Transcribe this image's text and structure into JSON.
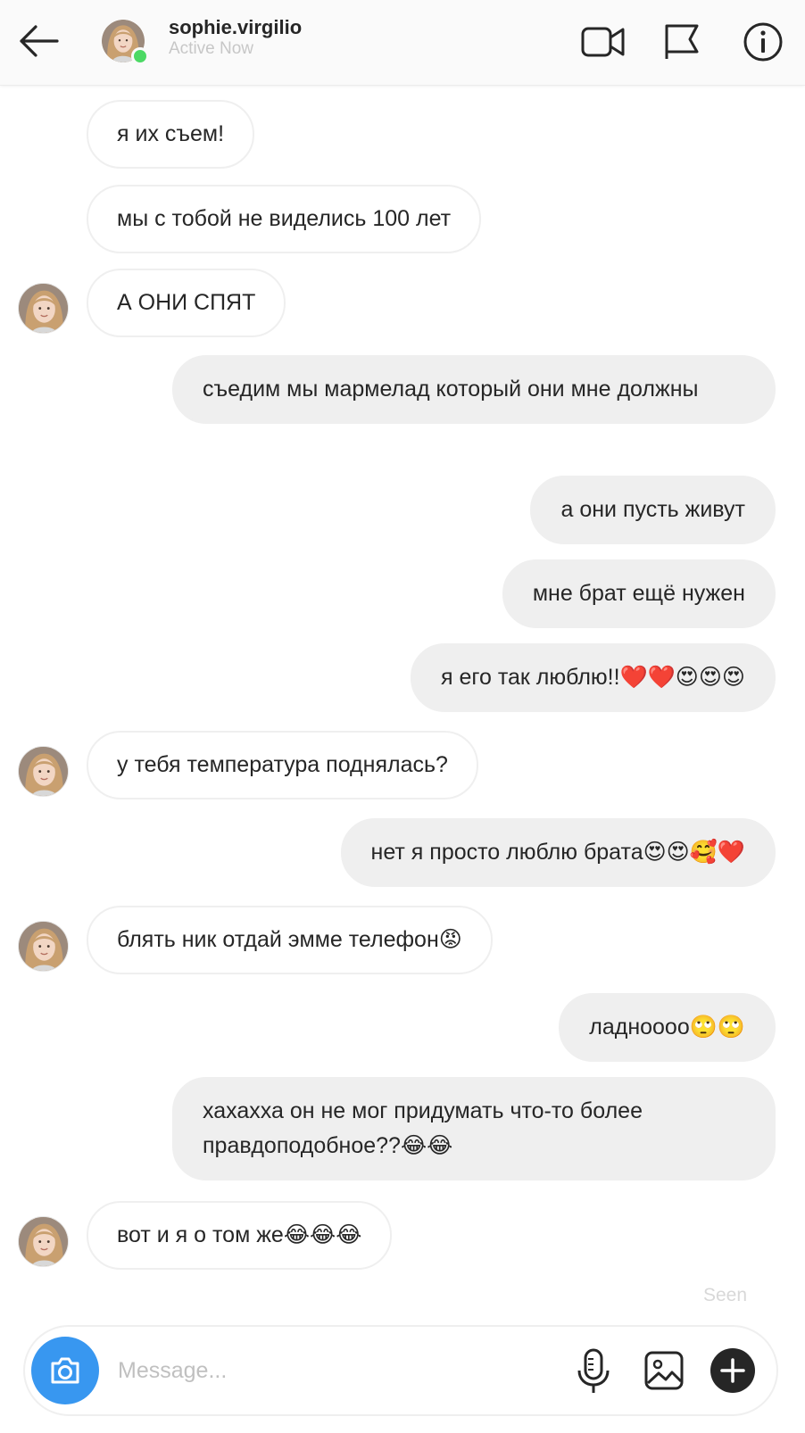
{
  "header": {
    "username": "sophie.virgilio",
    "status": "Active Now",
    "icons": [
      "back-arrow-icon",
      "video-call-icon",
      "flag-icon",
      "info-icon"
    ]
  },
  "messages": [
    {
      "side": "in",
      "text": "я их съем!"
    },
    {
      "side": "in",
      "text": "мы с тобой не виделись 100 лет"
    },
    {
      "side": "in",
      "text": "А ОНИ СПЯТ",
      "avatar": true
    },
    {
      "side": "out",
      "text": "съедим мы мармелад который они мне должны"
    },
    {
      "side": "out",
      "text": "а они пусть живут"
    },
    {
      "side": "out",
      "text": "мне брат ещё нужен"
    },
    {
      "side": "out",
      "text": "я его так люблю!!❤️❤️😍😍😍"
    },
    {
      "side": "in",
      "text": "у тебя температура поднялась?",
      "avatar": true
    },
    {
      "side": "out",
      "text": "нет я просто люблю брата😍😍🥰❤️"
    },
    {
      "side": "in",
      "text": "блять ник отдай эмме телефон😡",
      "avatar": true
    },
    {
      "side": "out",
      "text": "ладноооо🙄🙄"
    },
    {
      "side": "out",
      "text": "хахахха он не мог придумать что-то более правдоподобное??😂😂"
    },
    {
      "side": "in",
      "text": "вот и я о том же😂😂😂",
      "avatar": true
    }
  ],
  "seen_label": "Seen",
  "composer": {
    "placeholder": "Message...",
    "icons": [
      "camera-icon",
      "microphone-icon",
      "gallery-icon",
      "plus-icon"
    ]
  },
  "colors": {
    "accent": "#3897f0",
    "online": "#4cd964",
    "outgoing_bubble": "#efefef",
    "incoming_border": "#efefef"
  }
}
